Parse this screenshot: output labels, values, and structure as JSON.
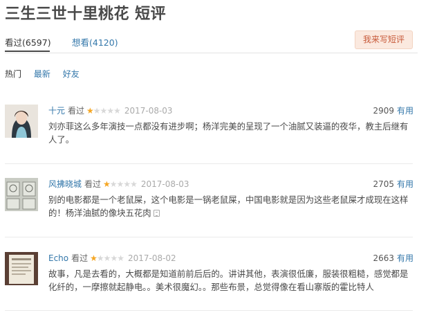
{
  "page": {
    "title": "三生三世十里桃花 短评"
  },
  "tabs": {
    "watched": "看过(6597)",
    "want": "想看(4120)"
  },
  "write_button": "我来写短评",
  "sorts": [
    "热门",
    "最新",
    "好友"
  ],
  "reviews": [
    {
      "user": "十元",
      "action": "看过",
      "rating": 1,
      "date": "2017-08-03",
      "votes": "2909",
      "useful_label": "有用",
      "text": "刘亦菲这么多年演技一点都没有进步啊；杨洋完美的呈现了一个油腻又装逼的夜华，教主后继有人了。"
    },
    {
      "user": "风拂晓城",
      "action": "看过",
      "rating": 1,
      "date": "2017-08-03",
      "votes": "2705",
      "useful_label": "有用",
      "text": "别的电影都是一个老鼠屎，这个电影是一锅老鼠屎，中国电影就是因为这些老鼠屎才成现在这样的！杨洋油腻的像块五花肉"
    },
    {
      "user": "Echo",
      "action": "看过",
      "rating": 1,
      "date": "2017-08-02",
      "votes": "2663",
      "useful_label": "有用",
      "text": "故事，凡是去看的，大概都是知道前前后后的。讲讲其他，表演很低廉，服装很粗糙，感觉都是化纤的，一摩擦就起静电。。美术很魔幻。。那些布景，总觉得像在看山寨版的霍比特人"
    }
  ]
}
